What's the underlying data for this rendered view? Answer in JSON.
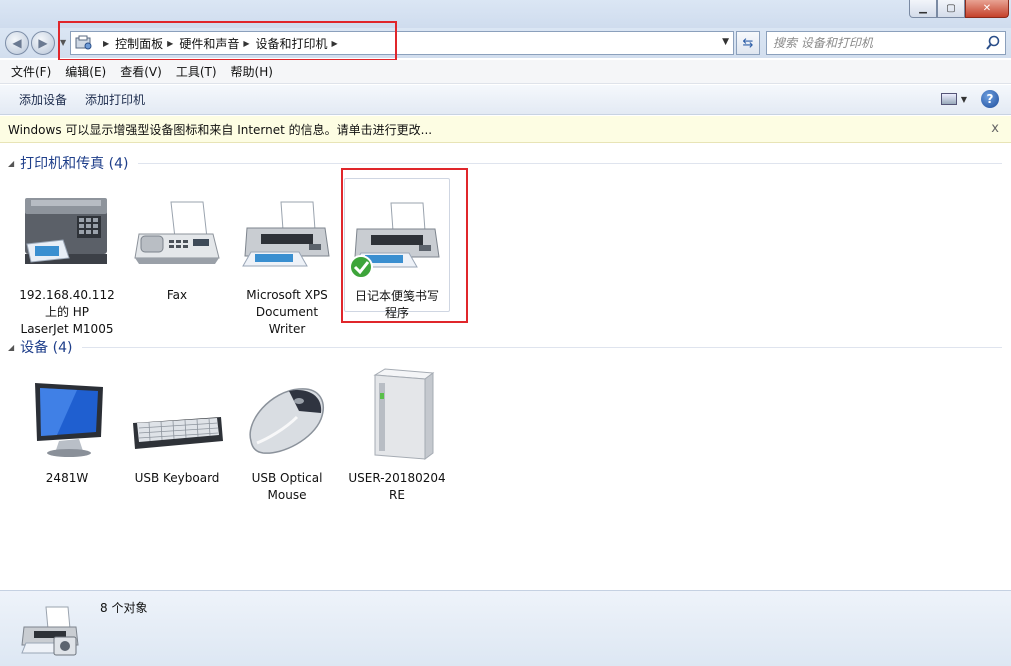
{
  "address_bar": {
    "crumbs": [
      "控制面板",
      "硬件和声音",
      "设备和打印机"
    ]
  },
  "search": {
    "placeholder": "搜索 设备和打印机"
  },
  "menu": {
    "items": [
      "文件(F)",
      "编辑(E)",
      "查看(V)",
      "工具(T)",
      "帮助(H)"
    ]
  },
  "toolbar": {
    "add_device": "添加设备",
    "add_printer": "添加打印机"
  },
  "infobar": {
    "message": "Windows 可以显示增强型设备图标和来自 Internet 的信息。请单击进行更改...",
    "close": "x"
  },
  "groups": {
    "printers": {
      "title": "打印机和传真 (4)",
      "items": [
        {
          "label": "192.168.40.112\n上的 HP\nLaserJet M1005",
          "icon": "mfp-printer-icon"
        },
        {
          "label": "Fax",
          "icon": "fax-icon"
        },
        {
          "label": "Microsoft XPS\nDocument\nWriter",
          "icon": "printer-icon"
        },
        {
          "label": "日记本便笺书写\n程序",
          "icon": "printer-icon",
          "default": true
        }
      ]
    },
    "devices": {
      "title": "设备 (4)",
      "items": [
        {
          "label": "2481W",
          "icon": "monitor-icon"
        },
        {
          "label": "USB Keyboard",
          "icon": "keyboard-icon"
        },
        {
          "label": "USB Optical\nMouse",
          "icon": "mouse-icon"
        },
        {
          "label": "USER-20180204\nRE",
          "icon": "computer-tower-icon"
        }
      ]
    }
  },
  "status": {
    "count_text": "8 个对象"
  },
  "colors": {
    "group_title": "#1e3e8a",
    "highlight": "#e0262b",
    "infobar_bg": "#fdfde3"
  }
}
